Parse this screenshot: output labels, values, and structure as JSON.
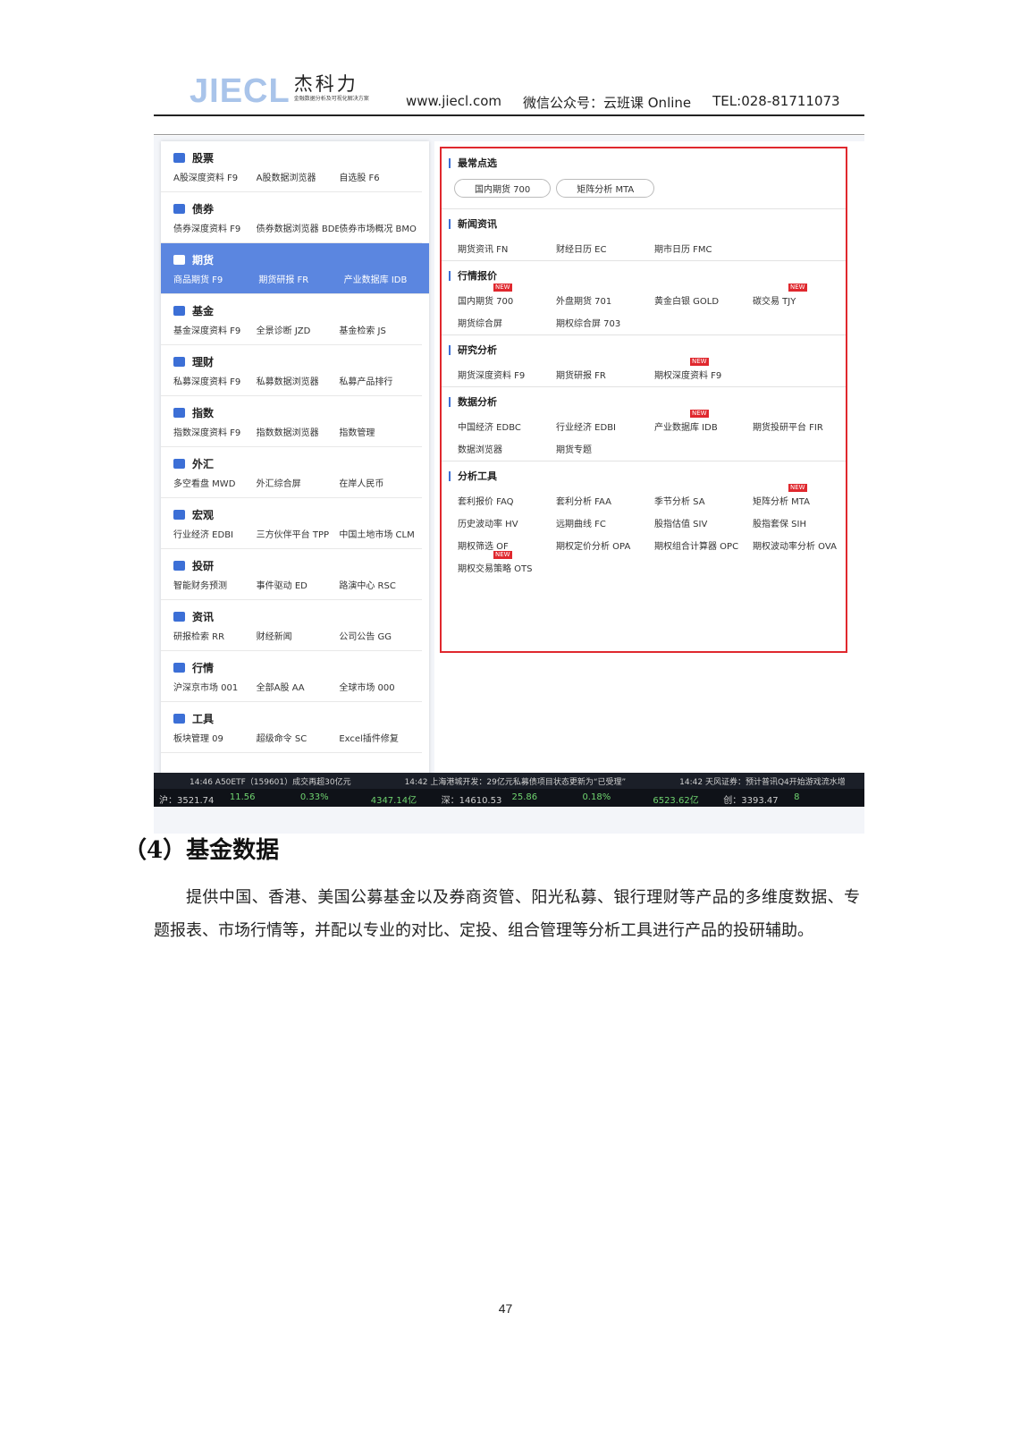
{
  "header": {
    "logo_text": "JIECL",
    "logo_cn": "杰科力",
    "logo_tagline": "金融数据分析及可视化解决方案",
    "website": "www.jiecl.com",
    "wechat": "微信公众号：云班课 Online",
    "tel": "TEL:028-81711073"
  },
  "sidebar": {
    "categories": [
      {
        "title": "股票",
        "items": [
          "A股深度资料 F9",
          "A股数据浏览器",
          "自选股 F6"
        ]
      },
      {
        "title": "债券",
        "items": [
          "债券深度资料 F9",
          "债券数据浏览器 BDE",
          "债券市场概况 BMO"
        ]
      },
      {
        "title": "期货",
        "items": [
          "商品期货 F9",
          "期货研报 FR",
          "产业数据库 IDB"
        ]
      },
      {
        "title": "基金",
        "items": [
          "基金深度资料 F9",
          "全景诊断 JZD",
          "基金检索 JS"
        ]
      },
      {
        "title": "理财",
        "items": [
          "私募深度资料 F9",
          "私募数据浏览器",
          "私募产品排行"
        ]
      },
      {
        "title": "指数",
        "items": [
          "指数深度资料 F9",
          "指数数据浏览器",
          "指数管理"
        ]
      },
      {
        "title": "外汇",
        "items": [
          "多空看盘 MWD",
          "外汇综合屏",
          "在岸人民币"
        ]
      },
      {
        "title": "宏观",
        "items": [
          "行业经济 EDBI",
          "三方伙伴平台 TPP",
          "中国土地市场 CLM"
        ]
      },
      {
        "title": "投研",
        "items": [
          "智能财务预测",
          "事件驱动 ED",
          "路演中心 RSC"
        ]
      },
      {
        "title": "资讯",
        "items": [
          "研报检索 RR",
          "财经新闻",
          "公司公告 GG"
        ]
      },
      {
        "title": "行情",
        "items": [
          "沪深京市场 001",
          "全部A股 AA",
          "全球市场 000"
        ]
      },
      {
        "title": "工具",
        "items": [
          "板块管理 09",
          "超级命令 SC",
          "Excel插件修复"
        ]
      }
    ]
  },
  "menu": {
    "frequent": {
      "title": "最常点选",
      "pills": [
        "国内期货 700",
        "矩阵分析 MTA"
      ]
    },
    "news": {
      "title": "新闻资讯",
      "items": [
        "期货资讯 FN",
        "财经日历 EC",
        "期市日历 FMC"
      ]
    },
    "quotes": {
      "title": "行情报价",
      "items": [
        "国内期货 700",
        "外盘期货 701",
        "黄金白银 GOLD",
        "碳交易 TJY",
        "期货综合屏",
        "期权综合屏 703"
      ]
    },
    "research": {
      "title": "研究分析",
      "items": [
        "期货深度资料 F9",
        "期货研报 FR",
        "期权深度资料 F9"
      ]
    },
    "data": {
      "title": "数据分析",
      "items": [
        "中国经济 EDBC",
        "行业经济 EDBI",
        "产业数据库 IDB",
        "期货投研平台 FIR",
        "数据浏览器",
        "期货专题"
      ]
    },
    "tools": {
      "title": "分析工具",
      "items": [
        "套利报价 FAQ",
        "套利分析 FAA",
        "季节分析 SA",
        "矩阵分析 MTA",
        "历史波动率 HV",
        "远期曲线 FC",
        "股指估值 SIV",
        "股指套保 SIH",
        "期权筛选 OF",
        "期权定价分析 OPA",
        "期权组合计算器 OPC",
        "期权波动率分析 OVA",
        "期权交易策略 OTS"
      ]
    },
    "new_badge": "NEW"
  },
  "ticker": {
    "news": [
      "14:46 A50ETF（159601）成交再超30亿元",
      "14:42 上海港城开发：29亿元私募债项目状态更新为“已受理”",
      "14:42 天风证券：预计普讯Q4开始游戏流水增"
    ],
    "quotes": [
      "沪：3521.74",
      "11.56",
      "0.33%",
      "4347.14亿",
      "深：14610.53",
      "25.86",
      "0.18%",
      "6523.62亿",
      "创：3393.47",
      "8"
    ]
  },
  "body": {
    "heading": "（4）基金数据",
    "paragraph": "提供中国、香港、美国公募基金以及券商资管、阳光私募、银行理财等产品的多维度数据、专题报表、市场行情等，并配以专业的对比、定投、组合管理等分析工具进行产品的投研辅助。",
    "page_number": "47"
  }
}
